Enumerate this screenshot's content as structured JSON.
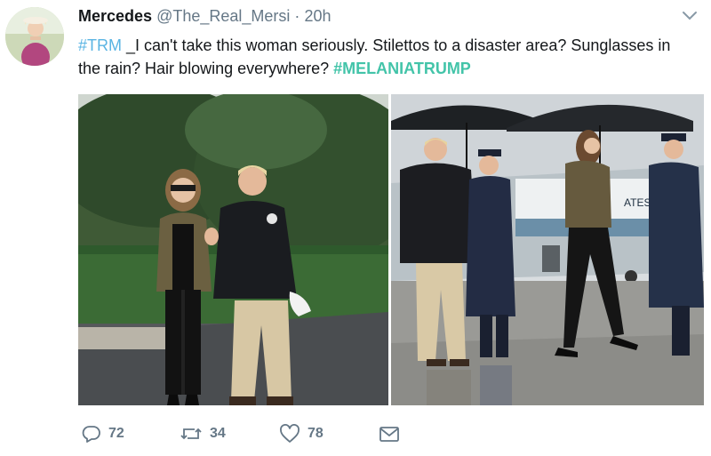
{
  "user": {
    "name": "Mercedes",
    "handle": "@The_Real_Mersi",
    "separator": "·",
    "time": "20h"
  },
  "tweet": {
    "hashtag1": "#TRM",
    "text": " _I can't take this woman seriously. Stilettos to a disaster area? Sunglasses in the rain? Hair blowing everywhere? ",
    "hashtag2": "#MELANIATRUMP"
  },
  "photos": {
    "right_plane_text": "ATES OF"
  },
  "actions": {
    "reply_count": "72",
    "retweet_count": "34",
    "like_count": "78"
  },
  "icons": {
    "reply": "reply-icon",
    "retweet": "retweet-icon",
    "like": "heart-icon",
    "dm": "envelope-icon",
    "menu": "chevron-down-icon"
  },
  "colors": {
    "hashtag": "#5ab4e3",
    "hashtag_alt": "#43c4a9",
    "muted": "#657786"
  }
}
